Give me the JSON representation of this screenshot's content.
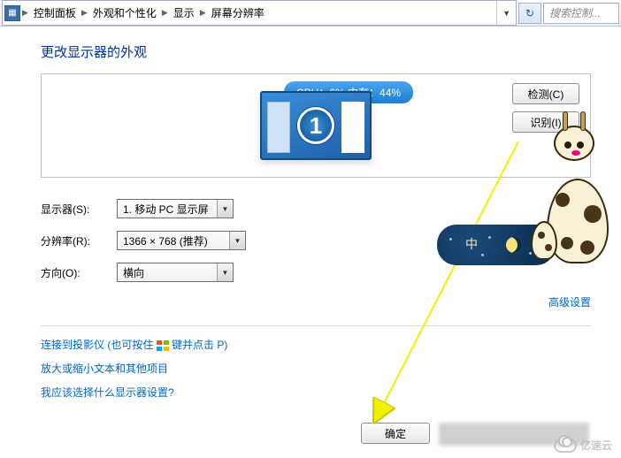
{
  "breadcrumb": {
    "items": [
      "控制面板",
      "外观和个性化",
      "显示",
      "屏幕分辨率"
    ]
  },
  "search": {
    "placeholder": "搜索控制..."
  },
  "page": {
    "title": "更改显示器的外观"
  },
  "preview": {
    "cpu_badge": "CPU：6%   内存：44%",
    "monitor_number": "1",
    "detect_btn": "检测(C)",
    "identify_btn": "识别(I)"
  },
  "form": {
    "display_label": "显示器(S):",
    "display_value": "1. 移动 PC 显示屏",
    "resolution_label": "分辨率(R):",
    "resolution_value": "1366 × 768 (推荐)",
    "orientation_label": "方向(O):",
    "orientation_value": "横向"
  },
  "links": {
    "advanced": "高级设置",
    "projector_prefix": "连接到投影仪 (也可按住 ",
    "projector_suffix": " 键并点击 P)",
    "text_size": "放大或缩小文本和其他项目",
    "which_display": "我应该选择什么显示器设置?"
  },
  "buttons": {
    "ok": "确定"
  },
  "mascot": {
    "badge_text": "中"
  },
  "watermark": {
    "text": "亿速云"
  }
}
